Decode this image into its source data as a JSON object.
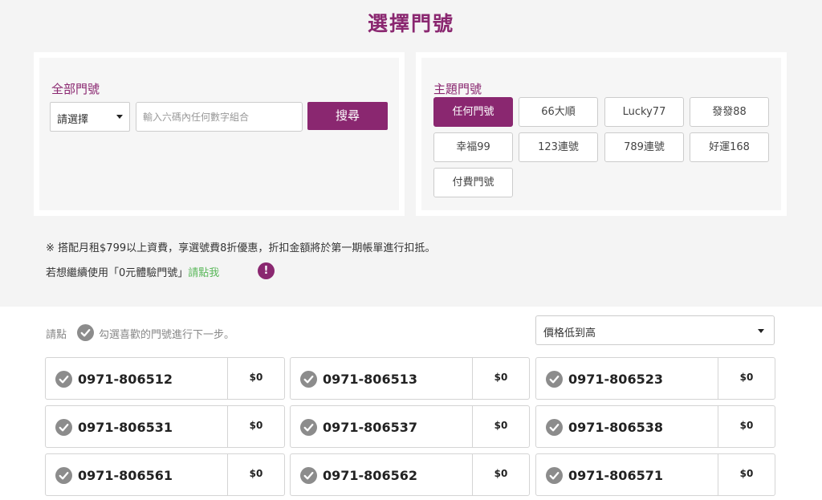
{
  "page_title": "選擇門號",
  "all_numbers": {
    "label": "全部門號",
    "select_value": "請選擇",
    "input_placeholder": "輸入六碼內任何數字組合",
    "search_label": "搜尋"
  },
  "theme_numbers": {
    "label": "主題門號",
    "buttons": [
      "任何門號",
      "66大順",
      "Lucky77",
      "發發88",
      "幸福99",
      "123連號",
      "789連號",
      "好運168",
      "付費門號"
    ],
    "active_index": 0
  },
  "notes": {
    "line1": "※ 搭配月租$799以上資費，享選號費8折優惠，折扣金額將於第一期帳單進行扣抵。",
    "line2_prefix": "若想繼續使用「0元體驗門號」",
    "line2_link": "請點我",
    "info_symbol": "!"
  },
  "hint": {
    "prefix": "請點",
    "suffix": "勾選喜歡的門號進行下一步。"
  },
  "sort": {
    "selected": "價格低到高"
  },
  "numbers": [
    {
      "number": "0971-806512",
      "price": "$0"
    },
    {
      "number": "0971-806513",
      "price": "$0"
    },
    {
      "number": "0971-806523",
      "price": "$0"
    },
    {
      "number": "0971-806531",
      "price": "$0"
    },
    {
      "number": "0971-806537",
      "price": "$0"
    },
    {
      "number": "0971-806538",
      "price": "$0"
    },
    {
      "number": "0971-806561",
      "price": "$0"
    },
    {
      "number": "0971-806562",
      "price": "$0"
    },
    {
      "number": "0971-806571",
      "price": "$0"
    }
  ],
  "colors": {
    "brand": "#8a2770",
    "link_green": "#5bb85b",
    "check_gray": "#8c8c8c"
  },
  "icons": {
    "check": "check-circle-icon",
    "caret": "caret-down-icon",
    "info": "exclamation-icon"
  }
}
